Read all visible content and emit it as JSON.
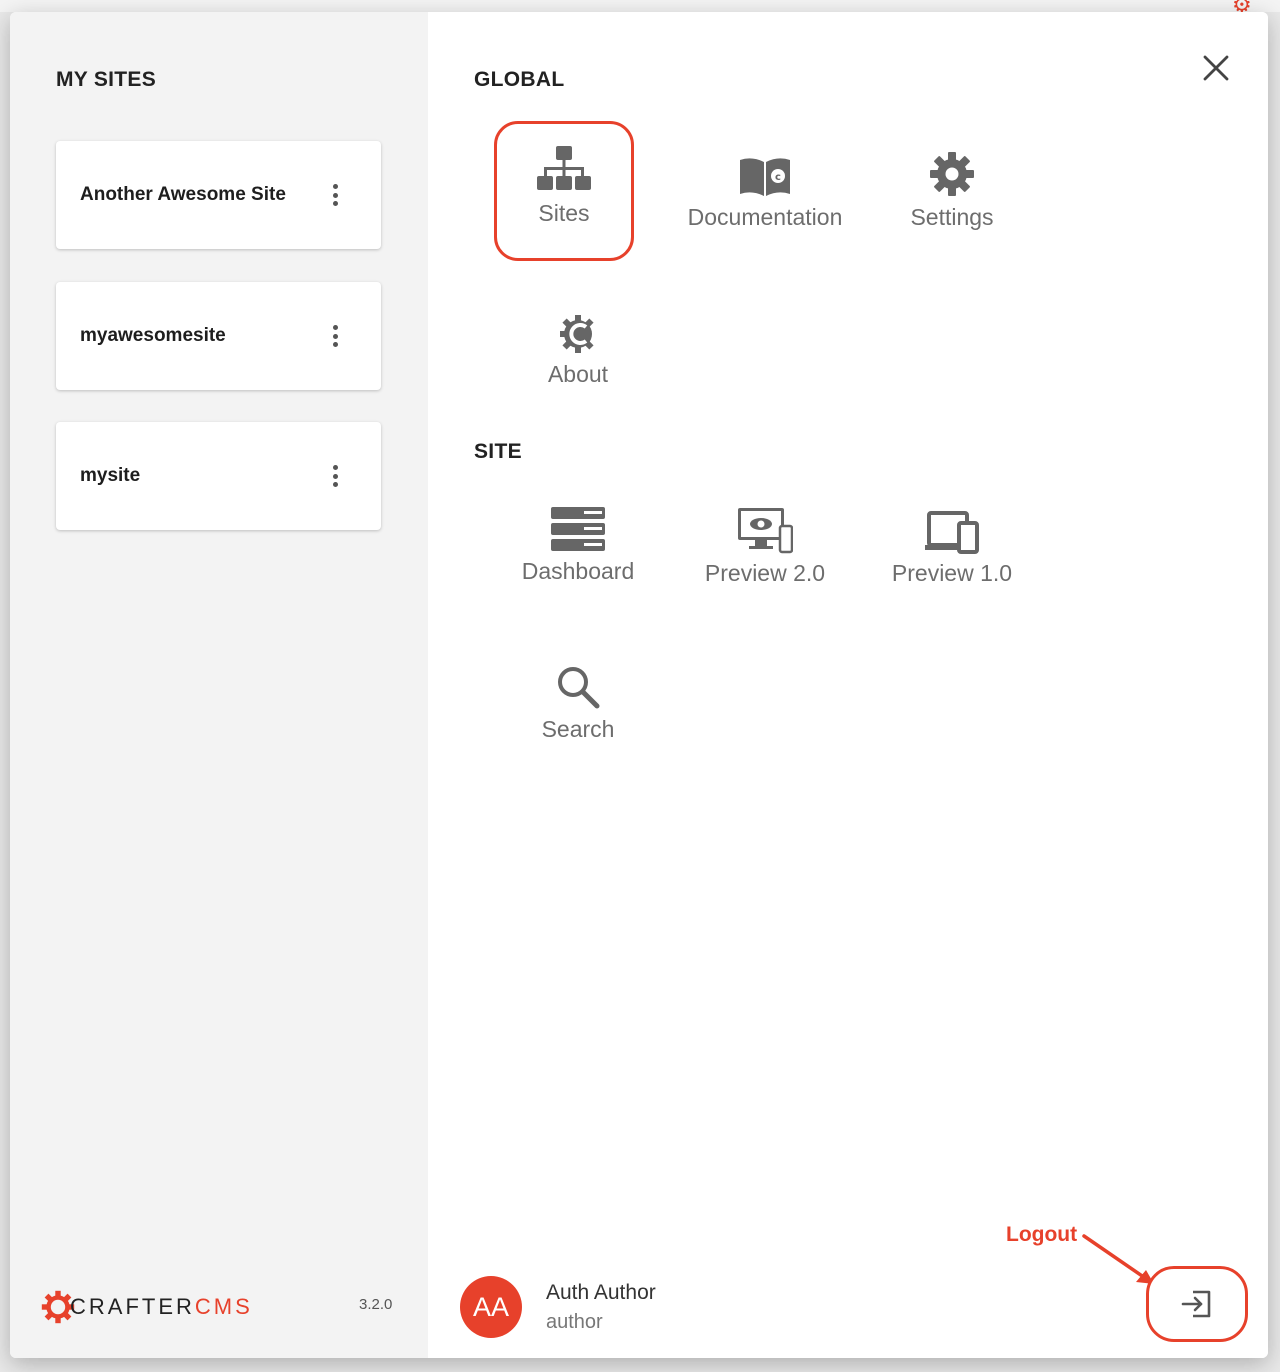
{
  "left_panel": {
    "title": "MY SITES",
    "sites": [
      {
        "name": "Another Awesome Site"
      },
      {
        "name": "myawesomesite"
      },
      {
        "name": "mysite"
      }
    ],
    "brand": {
      "crafter": "CRAFTER",
      "cms": "CMS"
    },
    "version": "3.2.0"
  },
  "right_panel": {
    "global_title": "GLOBAL",
    "global_items": [
      {
        "label": "Sites",
        "icon": "sitemap-icon",
        "highlighted": true
      },
      {
        "label": "Documentation",
        "icon": "book-icon"
      },
      {
        "label": "Settings",
        "icon": "gear-icon"
      },
      {
        "label": "About",
        "icon": "crafter-logo-icon"
      }
    ],
    "site_title": "SITE",
    "site_items": [
      {
        "label": "Dashboard",
        "icon": "dashboard-icon"
      },
      {
        "label": "Preview 2.0",
        "icon": "preview-devices-icon"
      },
      {
        "label": "Preview 1.0",
        "icon": "devices-icon"
      },
      {
        "label": "Search",
        "icon": "search-icon"
      }
    ],
    "user": {
      "initials": "AA",
      "name": "Auth Author",
      "role": "author"
    },
    "annotation": {
      "logout_label": "Logout"
    }
  },
  "colors": {
    "accent": "#e7412b",
    "icon": "#666666",
    "panel_bg": "#f3f3f3"
  }
}
